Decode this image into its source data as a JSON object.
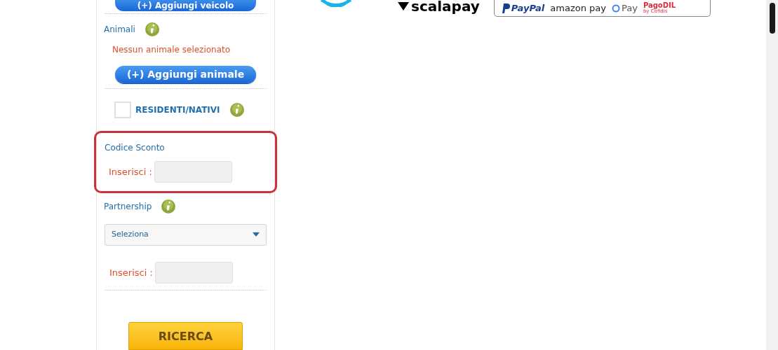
{
  "vehicles": {
    "add_button": "(+) Aggiungi veicolo"
  },
  "animals": {
    "title": "Animali",
    "empty_message": "Nessun animale selezionato",
    "add_button": "(+) Aggiungi animale"
  },
  "residents": {
    "label": "RESIDENTI/NATIVI",
    "checked": false
  },
  "discount_code": {
    "title": "Codice Sconto",
    "field_label": "Inserisci :",
    "highlighted": true
  },
  "partnership": {
    "title": "Partnership",
    "select": {
      "value": "Seleziona"
    },
    "field_label": "Inserisci :"
  },
  "search_button": "RICERCA",
  "payment_logos": {
    "scalapay": "scalapay",
    "paypal": "PayPal",
    "amazon_pay": "amazon pay",
    "google_pay": "Pay",
    "pagodil": "PagoDIL",
    "pagodil_by": "by Cofidis"
  }
}
